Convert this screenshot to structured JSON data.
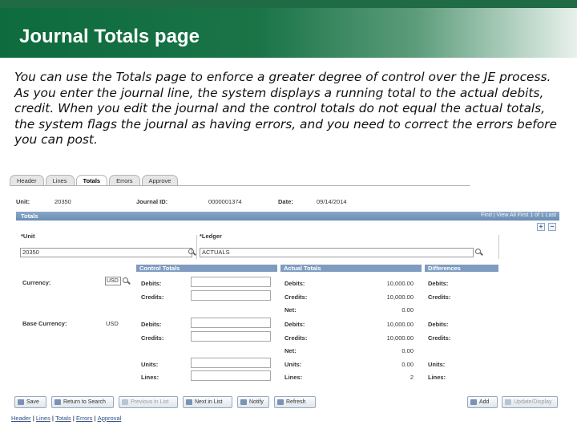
{
  "slide": {
    "title": "Journal Totals page",
    "intro": "You can use the Totals page to enforce a greater degree of control over the JE process. As you enter the journal line, the system displays a running total to the actual debits, credit. When you edit the journal and the control totals do not equal the actual totals, the system flags the journal as having errors, and you need to correct the errors before you can post."
  },
  "tabs": [
    "Header",
    "Lines",
    "Totals",
    "Errors",
    "Approve"
  ],
  "header_fields": {
    "unit_label": "Unit:",
    "unit_value": "20350",
    "journal_id_label": "Journal ID:",
    "journal_id_value": "0000001374",
    "date_label": "Date:",
    "date_value": "09/14/2014"
  },
  "grid": {
    "title": "Totals",
    "nav": "Find | View All   First  1 of 1  Last",
    "plus": "+",
    "minus": "−"
  },
  "unit_ledger": {
    "unit_label": "*Unit",
    "unit_value": "20350",
    "ledger_label": "*Ledger",
    "ledger_value": "ACTUALS"
  },
  "sections": {
    "control": "Control Totals",
    "actual": "Actual Totals",
    "differences": "Differences"
  },
  "currency": {
    "currency_label": "Currency:",
    "currency_value": "USD",
    "base_label": "Base Currency:",
    "base_value": "USD"
  },
  "labels": {
    "debits": "Debits:",
    "credits": "Credits:",
    "net": "Net:",
    "units": "Units:",
    "lines": "Lines:"
  },
  "actual_values": {
    "debits": "10,000.00",
    "credits": "10,000.00",
    "net": "0.00",
    "base_debits": "10,000.00",
    "base_credits": "10,000.00",
    "base_net": "0.00",
    "units": "0.00",
    "lines": "2"
  },
  "buttons": {
    "save": "Save",
    "return_to_search": "Return to Search",
    "previous_in_list": "Previous in List",
    "next_in_list": "Next in List",
    "notify": "Notify",
    "refresh": "Refresh",
    "add": "Add",
    "update_display": "Update/Display"
  },
  "bottom_links": [
    "Header",
    "Lines",
    "Totals",
    "Errors",
    "Approval"
  ]
}
